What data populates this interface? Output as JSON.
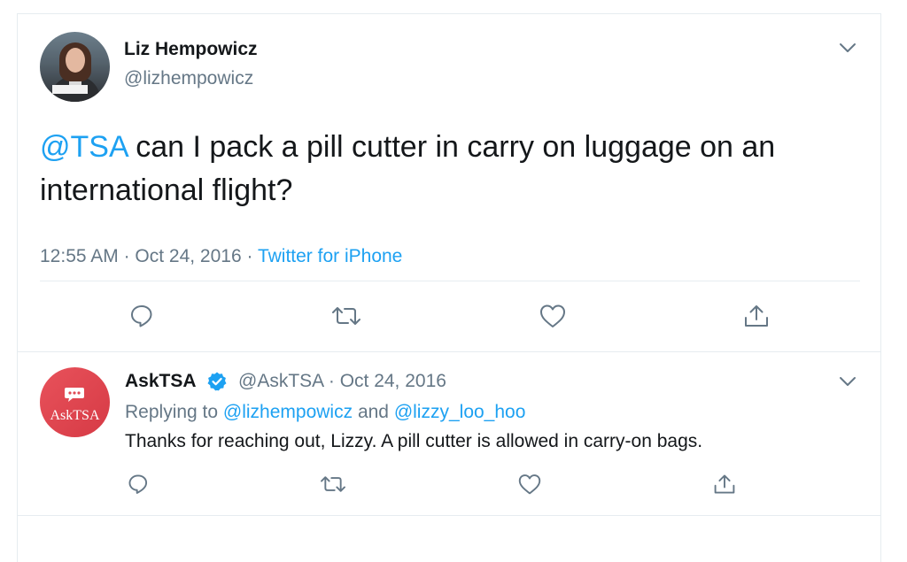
{
  "main_tweet": {
    "author_name": "Liz Hempowicz",
    "author_handle": "@lizhempowicz",
    "mention": "@TSA",
    "text": " can I pack a pill cutter in carry on luggage on an international flight?",
    "time": "12:55 AM",
    "date": "Oct 24, 2016",
    "sep": " · ",
    "source": "Twitter for iPhone"
  },
  "reply_tweet": {
    "author_name": "AskTSA",
    "author_handle": "@AskTSA",
    "date": "Oct 24, 2016",
    "sep": " · ",
    "replying_prefix": "Replying to ",
    "replying_to_1": "@lizhempowicz",
    "replying_and": " and ",
    "replying_to_2": "@lizzy_loo_hoo",
    "text": "Thanks for reaching out, Lizzy. A pill cutter is allowed in carry-on bags.",
    "avatar_label": "AskTSA"
  },
  "icons": [
    "chevron-down-icon",
    "reply-icon",
    "retweet-icon",
    "like-icon",
    "share-icon",
    "verified-badge-icon",
    "chat-bubble-icon"
  ],
  "colors": {
    "link": "#1da1f2",
    "muted": "#657786",
    "text": "#14171a",
    "asktsa_red": "#e04b55",
    "border": "#e6ecf0"
  }
}
